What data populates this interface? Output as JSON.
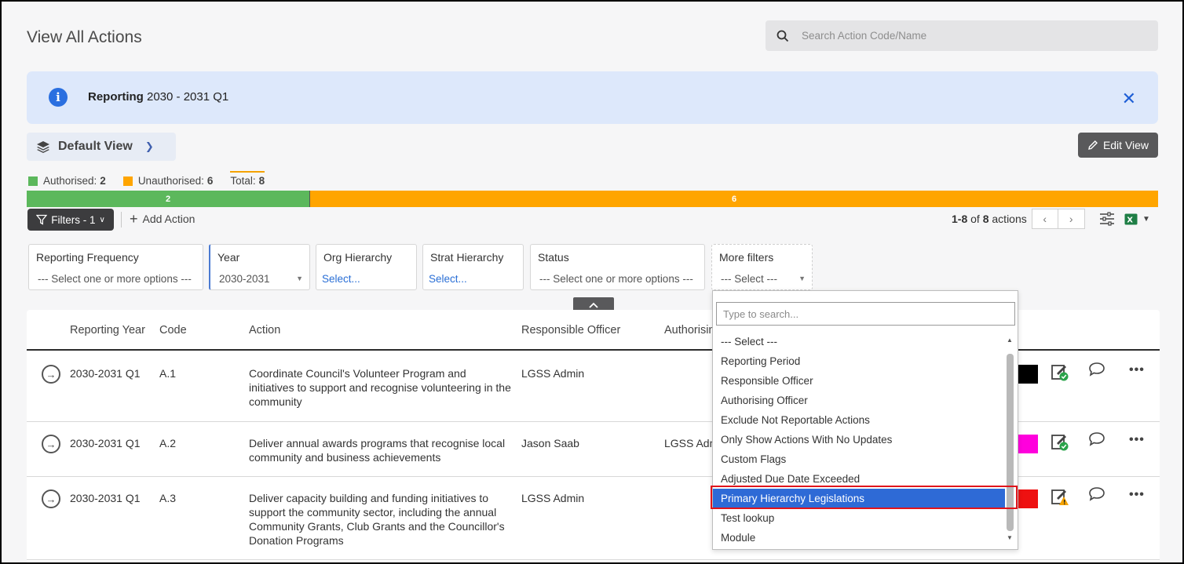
{
  "page_title": "View All Actions",
  "search": {
    "placeholder": "Search Action Code/Name"
  },
  "banner": {
    "label_bold": "Reporting",
    "label_rest": " 2030 - 2031 Q1"
  },
  "view": {
    "name": "Default View",
    "edit_label": "Edit View"
  },
  "legend": {
    "authorised_label": "Authorised:",
    "authorised_count": "2",
    "unauthorised_label": "Unauthorised:",
    "unauthorised_count": "6",
    "total_label": "Total:",
    "total_count": "8",
    "authorised_color": "#5cb85c",
    "unauthorised_color": "#ffa500"
  },
  "progress": {
    "authorised_value": "2",
    "unauthorised_value": "6",
    "authorised_fraction": 0.25,
    "unauthorised_fraction": 0.75
  },
  "toolbar": {
    "filters_label": "Filters - 1",
    "add_action_label": "Add Action"
  },
  "pager": {
    "range": "1-8",
    "of": " of ",
    "total": "8",
    "suffix": " actions"
  },
  "filters": {
    "reporting_frequency": {
      "label": "Reporting Frequency",
      "value": "--- Select one or more options ---"
    },
    "year": {
      "label": "Year",
      "value": "2030-2031"
    },
    "org_hierarchy": {
      "label": "Org Hierarchy",
      "value": "Select..."
    },
    "strat_hierarchy": {
      "label": "Strat Hierarchy",
      "value": "Select..."
    },
    "status": {
      "label": "Status",
      "value": "--- Select one or more options ---"
    },
    "more_filters": {
      "label": "More filters",
      "value": "--- Select ---"
    }
  },
  "table": {
    "headers": {
      "reporting_year": "Reporting Year",
      "code": "Code",
      "action": "Action",
      "responsible_officer": "Responsible Officer",
      "authorising": "Authorisin"
    },
    "rows": [
      {
        "year": "2030-2031 Q1",
        "code": "A.1",
        "action": "Coordinate Council's Volunteer Program and initiatives to support and recognise volunteering in the community",
        "officer": "LGSS Admin",
        "authorising": "",
        "flag_color": "#000000"
      },
      {
        "year": "2030-2031 Q1",
        "code": "A.2",
        "action": "Deliver annual awards programs that recognise local community and business achievements",
        "officer": "Jason Saab",
        "authorising": "LGSS Adm",
        "flag_color": "#ff00dd"
      },
      {
        "year": "2030-2031 Q1",
        "code": "A.3",
        "action": "Deliver capacity building and funding initiatives to support the community sector, including the annual Community Grants, Club Grants and the Councillor's Donation Programs",
        "officer": "LGSS Admin",
        "authorising": "",
        "flag_color": "#ee1111"
      }
    ]
  },
  "dropdown": {
    "search_placeholder": "Type to search...",
    "items": [
      "--- Select ---",
      "Reporting Period",
      "Responsible Officer",
      "Authorising Officer",
      "Exclude Not Reportable Actions",
      "Only Show Actions With No Updates",
      "Custom Flags",
      "Adjusted Due Date Exceeded",
      "Primary Hierarchy Legislations",
      "Test lookup",
      "Module"
    ],
    "selected_index": 8
  }
}
